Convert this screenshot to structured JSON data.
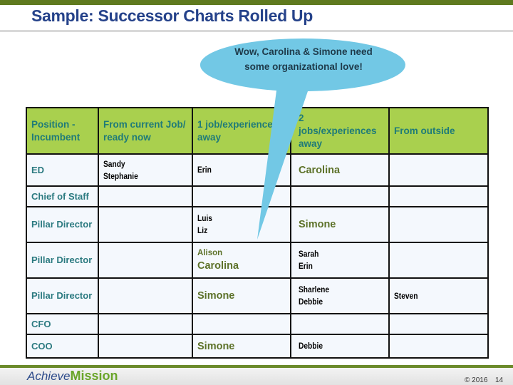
{
  "slide": {
    "title": "Sample: Successor Charts Rolled Up",
    "callout": "Wow, Carolina & Simone need some organizational love!",
    "footer": {
      "logo_part1": "Achieve",
      "logo_part2": "Mission",
      "copyright": "© 2016",
      "page_number": "14"
    }
  },
  "colors": {
    "header_green": "#a9d04e",
    "title_blue": "#25428a",
    "callout_blue": "#72c8e5",
    "highlight_olive": "#5d7229",
    "accent_teal": "#2b7a80"
  },
  "table": {
    "headers": [
      "Position - Incumbent",
      "From current Job/ ready now",
      "1 job/experience away",
      "2 jobs/experiences away",
      "From outside"
    ],
    "rows": [
      {
        "position": "ED",
        "ready_now": [
          "Sandy",
          "Stephanie"
        ],
        "one_away": [
          "Erin"
        ],
        "two_away": [
          "Carolina"
        ],
        "outside": []
      },
      {
        "position": "Chief of Staff",
        "ready_now": [],
        "one_away": [],
        "two_away": [],
        "outside": []
      },
      {
        "position": "Pillar Director",
        "ready_now": [],
        "one_away": [
          "Luis",
          "Liz"
        ],
        "two_away": [
          "Simone"
        ],
        "outside": []
      },
      {
        "position": "Pillar Director",
        "ready_now": [],
        "one_away": [
          "Alison",
          "Carolina"
        ],
        "two_away": [
          "Sarah",
          "Erin"
        ],
        "outside": []
      },
      {
        "position": "Pillar Director",
        "ready_now": [],
        "one_away": [
          "Simone"
        ],
        "two_away": [
          "Sharlene",
          "Debbie"
        ],
        "outside": [
          "Steven"
        ]
      },
      {
        "position": "CFO",
        "ready_now": [],
        "one_away": [],
        "two_away": [],
        "outside": []
      },
      {
        "position": "COO",
        "ready_now": [],
        "one_away": [
          "Simone"
        ],
        "two_away": [
          "Debbie"
        ],
        "outside": []
      }
    ]
  }
}
